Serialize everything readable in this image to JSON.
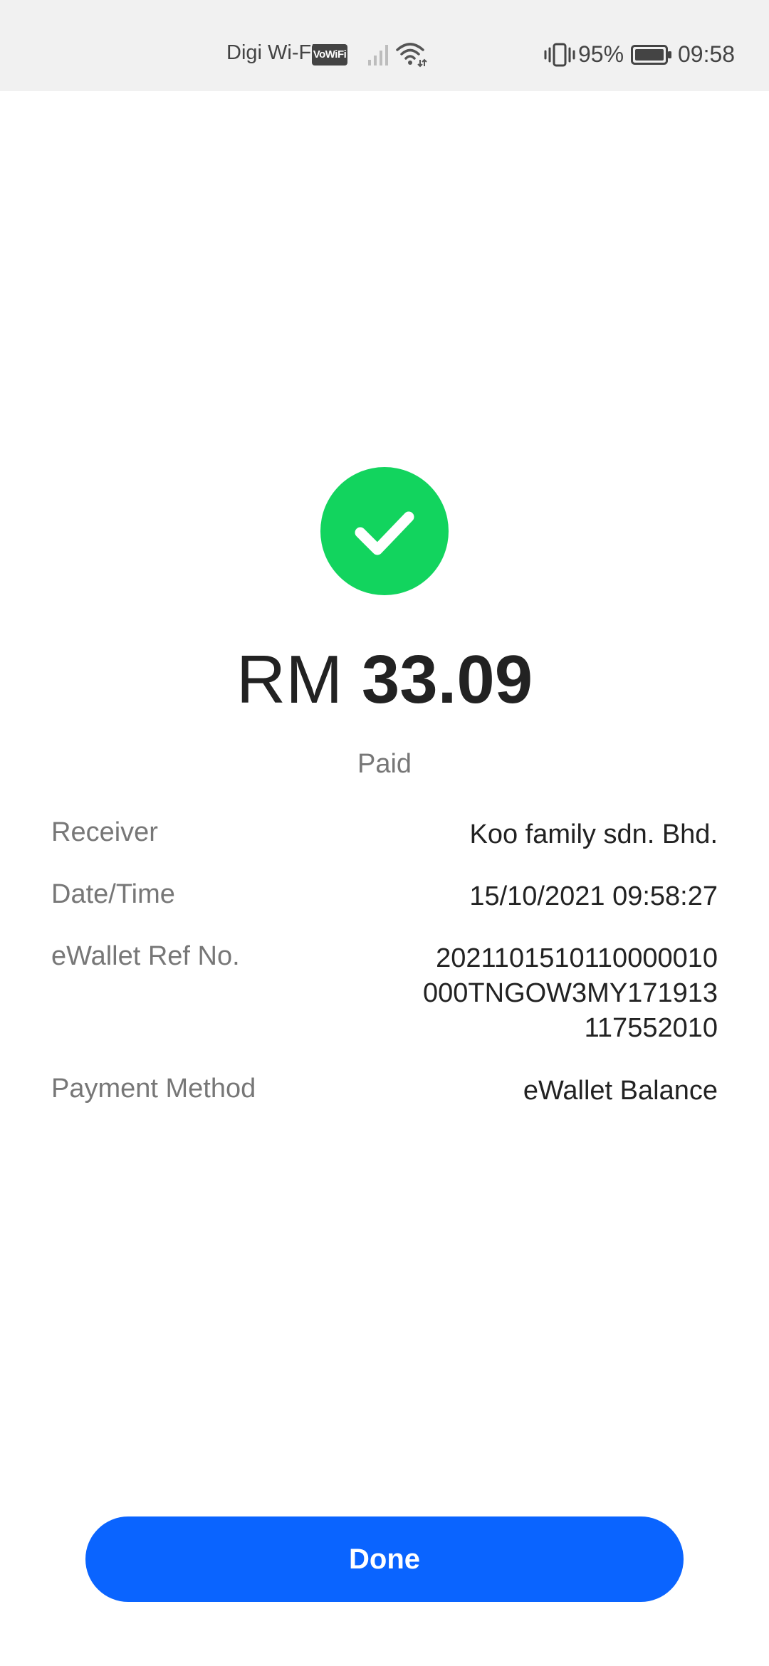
{
  "status_bar": {
    "carrier": "Digi Wi-Fi",
    "vowifi_badge": "VoWiFi",
    "battery_percent": "95%",
    "time": "09:58",
    "icons": [
      "vowifi-icon",
      "signal-icon",
      "wifi-icon",
      "vibrate-icon",
      "battery-icon"
    ]
  },
  "receipt": {
    "success_icon": "check-circle-icon",
    "success_color": "#12d45e",
    "currency": "RM",
    "amount": "33.09",
    "status": "Paid",
    "rows": [
      {
        "label": "Receiver",
        "value_lines": [
          "Koo family sdn. Bhd."
        ]
      },
      {
        "label": "Date/Time",
        "value_lines": [
          "15/10/2021 09:58:27"
        ]
      },
      {
        "label": "eWallet Ref No.",
        "value_lines": [
          "2021101510110000010",
          "000TNGOW3MY171913",
          "117552010"
        ]
      },
      {
        "label": "Payment Method",
        "value_lines": [
          "eWallet Balance"
        ]
      }
    ]
  },
  "actions": {
    "done_label": "Done",
    "button_color": "#0a64ff"
  }
}
